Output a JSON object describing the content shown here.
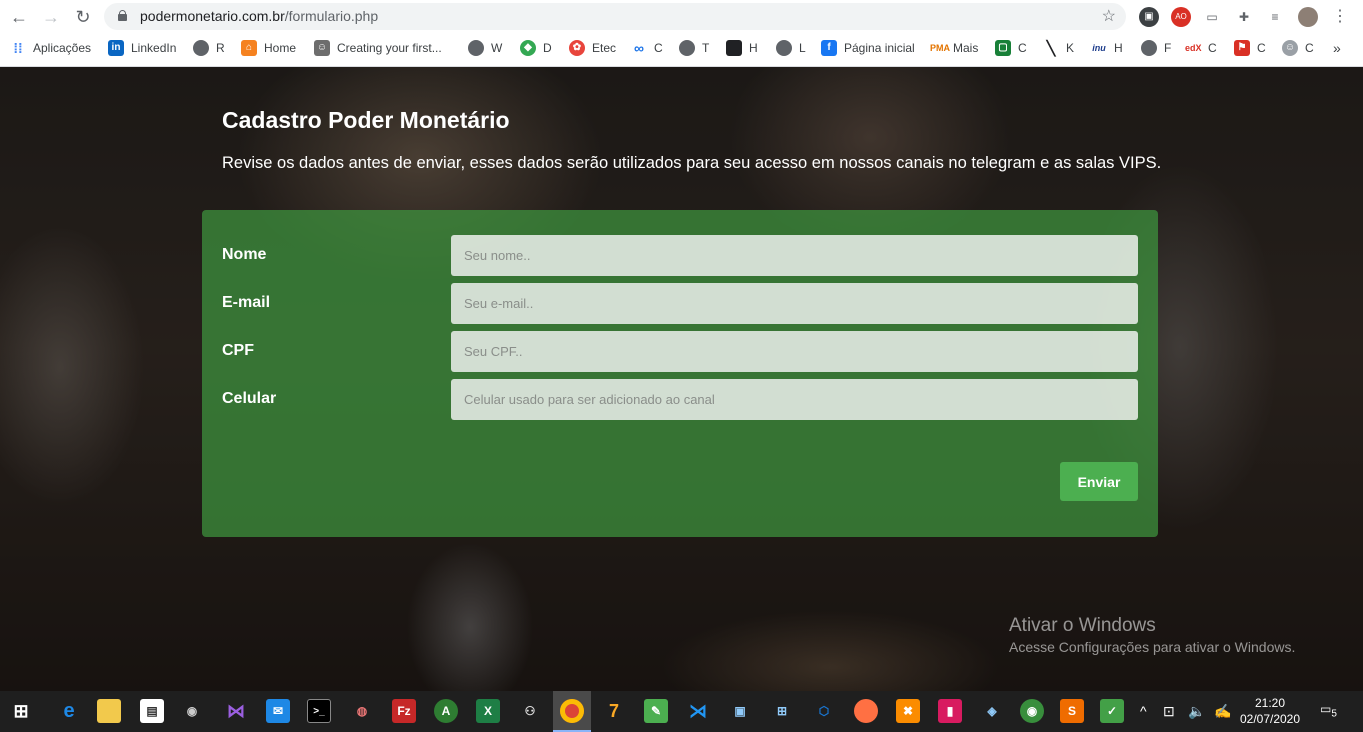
{
  "browser": {
    "url_domain": "podermonetario.com.br",
    "url_path": "/formulario.php",
    "bookmarks": [
      {
        "label": "Aplicações",
        "icon": "apps-grid-icon",
        "color": "#4285f4"
      },
      {
        "label": "LinkedIn",
        "icon": "linkedin-icon",
        "color": "#0a66c2"
      },
      {
        "label": "R",
        "icon": "r-icon",
        "color": "#5f6368"
      },
      {
        "label": "Home",
        "icon": "home-logo-icon",
        "color": "#f58220"
      },
      {
        "label": "Creating your first...",
        "icon": "robot-icon",
        "color": "#6d6d6d"
      },
      {
        "label": "W",
        "icon": "globe-icon",
        "color": "#5f6368"
      },
      {
        "label": "D",
        "icon": "diamond-icon",
        "color": "#34a853"
      },
      {
        "label": "Etec",
        "icon": "flower-icon",
        "color": "#e8453c"
      },
      {
        "label": "C",
        "icon": "infinity-icon",
        "color": "#1a73e8"
      },
      {
        "label": "T",
        "icon": "globe-icon",
        "color": "#5f6368"
      },
      {
        "label": "H",
        "icon": "square-icon",
        "color": "#202124"
      },
      {
        "label": "L",
        "icon": "globe-icon",
        "color": "#5f6368"
      },
      {
        "label": "Página inicial",
        "icon": "facebook-icon",
        "color": "#1877f2"
      },
      {
        "label": "Mais",
        "icon": "pma-icon",
        "color": "#e37400"
      },
      {
        "label": "C",
        "icon": "frame-icon",
        "color": "#188038"
      },
      {
        "label": "K",
        "icon": "knife-icon",
        "color": "#202124"
      },
      {
        "label": "H",
        "icon": "nu-icon",
        "color": "#1a3a8a"
      },
      {
        "label": "F",
        "icon": "globe-icon",
        "color": "#5f6368"
      },
      {
        "label": "C",
        "icon": "edx-icon",
        "color": "#d93025"
      },
      {
        "label": "C",
        "icon": "flag-icon",
        "color": "#d93025"
      },
      {
        "label": "C",
        "icon": "face-icon",
        "color": "#9aa0a6"
      }
    ],
    "overflow": "»"
  },
  "page": {
    "title": "Cadastro Poder Monetário",
    "subtitle": "Revise os dados antes de enviar, esses dados serão utilizados para seu acesso em nossos canais no telegram e as salas VIPS."
  },
  "form": {
    "fields": [
      {
        "label": "Nome",
        "placeholder": "Seu nome.."
      },
      {
        "label": "E-mail",
        "placeholder": "Seu e-mail.."
      },
      {
        "label": "CPF",
        "placeholder": "Seu CPF.."
      },
      {
        "label": "Celular",
        "placeholder": "Celular usado para ser adicionado ao canal"
      }
    ],
    "submit_label": "Enviar"
  },
  "watermark": {
    "line1": "Ativar o Windows",
    "line2": "Acesse Configurações para ativar o Windows."
  },
  "taskbar": {
    "time": "21:20",
    "date": "02/07/2020",
    "notification_count": "5"
  }
}
